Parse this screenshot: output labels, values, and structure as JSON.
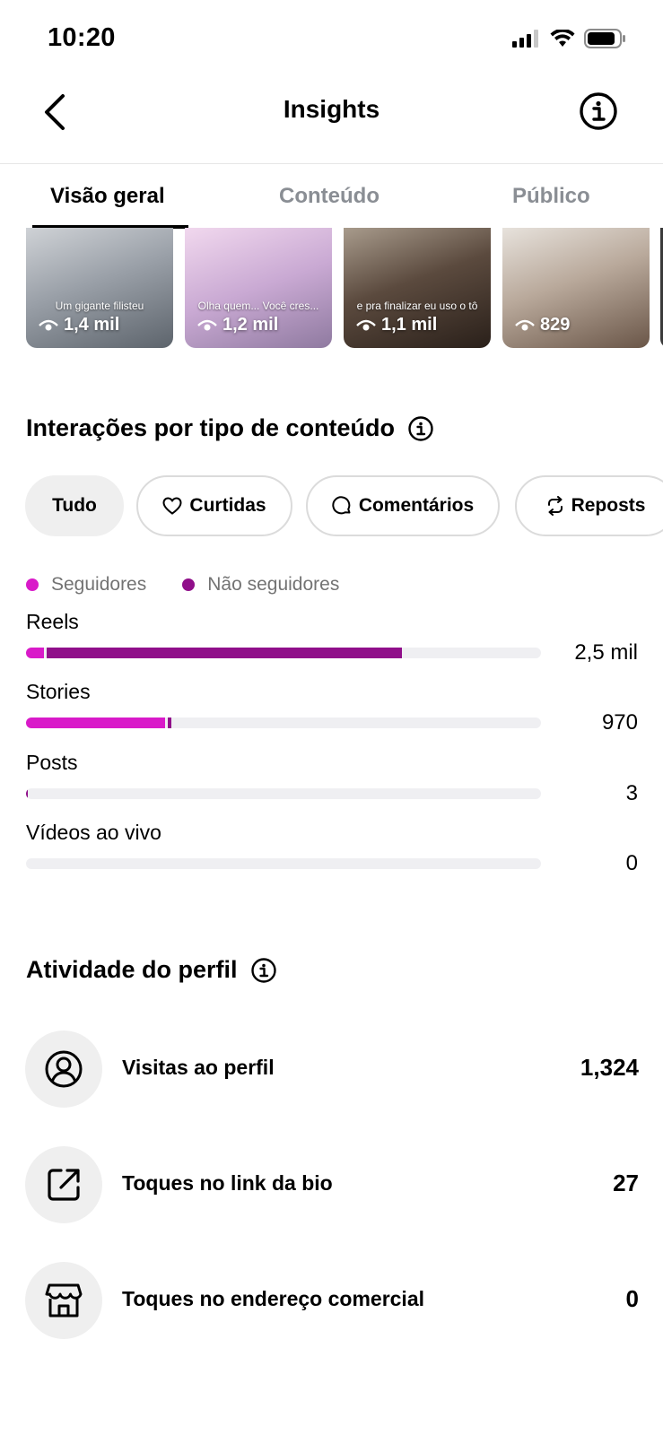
{
  "status_bar": {
    "time": "10:20"
  },
  "nav": {
    "title": "Insights"
  },
  "tabs": [
    {
      "label": "Visão geral"
    },
    {
      "label": "Conteúdo"
    },
    {
      "label": "Público"
    }
  ],
  "thumbnails": [
    {
      "views": "1,4 mil",
      "caption": "Um gigante filisteu"
    },
    {
      "views": "1,2 mil",
      "caption": "Olha quem... Você cres..."
    },
    {
      "views": "1,1 mil",
      "caption": "e pra finalizar eu uso o tô"
    },
    {
      "views": "829",
      "caption": ""
    }
  ],
  "interactions": {
    "title": "Interações por tipo de conteúdo",
    "filters": [
      {
        "label": "Tudo"
      },
      {
        "label": "Curtidas"
      },
      {
        "label": "Comentários"
      },
      {
        "label": "Reposts"
      }
    ],
    "legend": [
      {
        "label": "Seguidores",
        "color": "#d91ac9"
      },
      {
        "label": "Não seguidores",
        "color": "#900f8a"
      }
    ],
    "rows": [
      {
        "label": "Reels",
        "value": "2,5 mil",
        "followers_fraction": 0.035,
        "non_followers_fraction": 0.69
      },
      {
        "label": "Stories",
        "value": "970",
        "followers_fraction": 0.27,
        "non_followers_fraction": 0.007
      },
      {
        "label": "Posts",
        "value": "3",
        "followers_fraction": 0.0,
        "non_followers_fraction": 0.003
      },
      {
        "label": "Vídeos ao vivo",
        "value": "0",
        "followers_fraction": 0.0,
        "non_followers_fraction": 0.0
      }
    ]
  },
  "profile_activity": {
    "title": "Atividade do perfil",
    "items": [
      {
        "label": "Visitas ao perfil",
        "value": "1,324",
        "icon": "profile-icon"
      },
      {
        "label": "Toques no link da bio",
        "value": "27",
        "icon": "external-link-icon"
      },
      {
        "label": "Toques no endereço comercial",
        "value": "0",
        "icon": "storefront-icon"
      }
    ]
  }
}
